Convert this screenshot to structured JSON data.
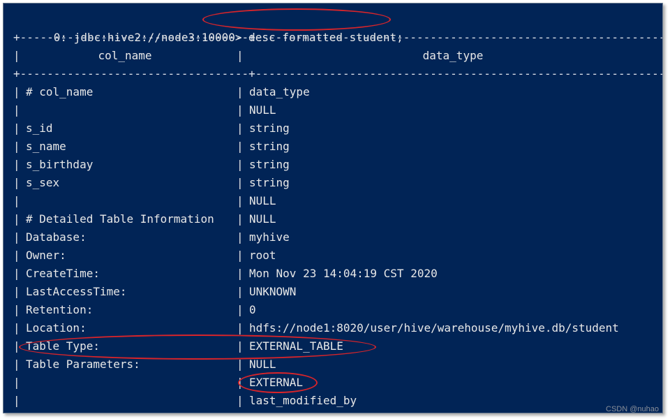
{
  "terminal": {
    "prompt": "0: jdbc:hive2://node3:10000>",
    "command": "desc formatted student;",
    "separator_left": "+----------------------------------+",
    "separator_right": "-------------------------------------------------------------",
    "header": {
      "col1": "col_name",
      "col2": "data_type"
    },
    "rows": [
      {
        "col1": "# col_name",
        "col2": "data_type"
      },
      {
        "col1": "",
        "col2": "NULL"
      },
      {
        "col1": "s_id",
        "col2": "string"
      },
      {
        "col1": "s_name",
        "col2": "string"
      },
      {
        "col1": "s_birthday",
        "col2": "string"
      },
      {
        "col1": "s_sex",
        "col2": "string"
      },
      {
        "col1": "",
        "col2": "NULL"
      },
      {
        "col1": "# Detailed Table Information",
        "col2": "NULL"
      },
      {
        "col1": "Database:",
        "col2": "myhive"
      },
      {
        "col1": "Owner:",
        "col2": "root"
      },
      {
        "col1": "CreateTime:",
        "col2": "Mon Nov 23 14:04:19 CST 2020"
      },
      {
        "col1": "LastAccessTime:",
        "col2": "UNKNOWN"
      },
      {
        "col1": "Retention:",
        "col2": "0"
      },
      {
        "col1": "Location:",
        "col2": "hdfs://node1:8020/user/hive/warehouse/myhive.db/student"
      },
      {
        "col1": "Table Type:",
        "col2": "EXTERNAL_TABLE"
      },
      {
        "col1": "Table Parameters:",
        "col2": "NULL"
      },
      {
        "col1": "",
        "col2": "EXTERNAL"
      },
      {
        "col1": "",
        "col2": "last_modified_by"
      }
    ],
    "pipe": "|"
  },
  "watermark": "CSDN @nuhao",
  "colors": {
    "background": "#012456",
    "text": "#e8e8e8",
    "highlight": "#d8242a"
  }
}
